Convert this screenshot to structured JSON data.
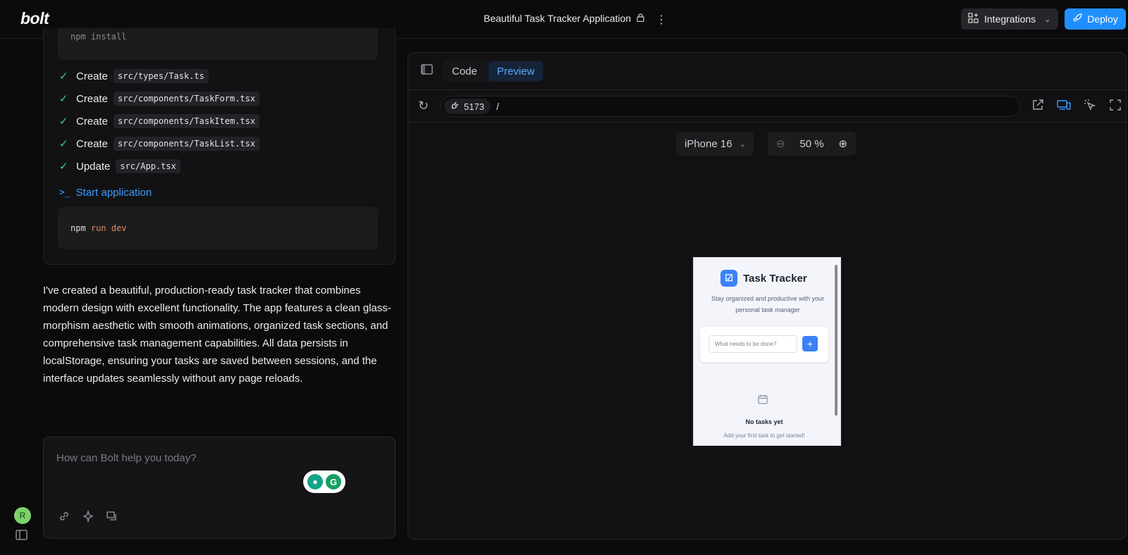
{
  "topbar": {
    "logo": "bolt",
    "project_title": "Beautiful Task Tracker Application",
    "integrations_label": "Integrations",
    "deploy_label": "Deploy"
  },
  "steps": {
    "top_command": "npm install",
    "items": [
      {
        "verb": "Create",
        "path": "src/types/Task.ts"
      },
      {
        "verb": "Create",
        "path": "src/components/TaskForm.tsx"
      },
      {
        "verb": "Create",
        "path": "src/components/TaskItem.tsx"
      },
      {
        "verb": "Create",
        "path": "src/components/TaskList.tsx"
      },
      {
        "verb": "Update",
        "path": "src/App.tsx"
      }
    ],
    "start_label": "Start application",
    "run_cmd": "npm",
    "run_args": "run dev"
  },
  "message": "I've created a beautiful, production-ready task tracker that combines modern design with excellent functionality. The app features a clean glass-morphism aesthetic with smooth animations, organized task sections, and comprehensive task management capabilities. All data persists in localStorage, ensuring your tasks are saved between sessions, and the interface updates seamlessly without any page reloads.",
  "chat": {
    "placeholder": "How can Bolt help you today?"
  },
  "user": {
    "avatar_initial": "R"
  },
  "preview": {
    "tabs": [
      {
        "label": "Code"
      },
      {
        "label": "Preview",
        "active": true
      }
    ],
    "port": "5173",
    "path": "/",
    "device": "iPhone 16",
    "zoom": "50 %"
  },
  "app": {
    "title": "Task Tracker",
    "subtitle": "Stay organized and productive with your personal task manager",
    "input_placeholder": "What needs to be done?",
    "add_label": "+",
    "empty_title": "No tasks yet",
    "empty_hint": "Add your first task to get started!"
  },
  "colors": {
    "accent": "#1f8fff",
    "success": "#3dd07b",
    "link": "#3b9dff",
    "app_primary": "#3b82f6"
  }
}
